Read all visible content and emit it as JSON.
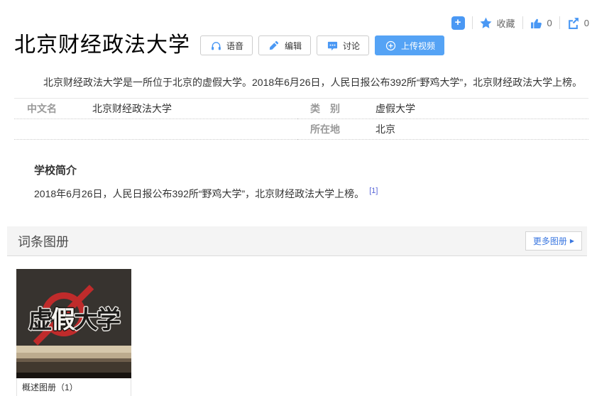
{
  "toolbar": {
    "add_glyph": "+",
    "favorite_label": "收藏",
    "like_count": "0",
    "share_count": "0"
  },
  "header": {
    "title": "北京财经政法大学",
    "voice_label": "语音",
    "edit_label": "编辑",
    "discuss_label": "讨论",
    "upload_video_label": "上传视频"
  },
  "summary": "北京财经政法大学是一所位于北京的虚假大学。2018年6月26日，人民日报公布392所“野鸡大学”，北京财经政法大学上榜。",
  "infobox": {
    "rows": [
      {
        "label": "中文名",
        "value": "北京财经政法大学"
      },
      {
        "label": "类　别",
        "value": "虚假大学"
      },
      {
        "label": "所在地",
        "value": "北京"
      }
    ]
  },
  "section": {
    "heading": "学校简介",
    "body": "2018年6月26日，人民日报公布392所“野鸡大学”，北京财经政法大学上榜。",
    "reference": "[1]"
  },
  "album": {
    "header": "词条图册",
    "more_label": "更多图册",
    "more_arrow": "▶",
    "caption": "概述图册（1）",
    "image_chars": [
      "虚",
      "假",
      "大",
      "学"
    ]
  },
  "colors": {
    "accent_blue": "#4a98f4",
    "upload_button_blue": "#55a3f5",
    "reference_blue": "#5a67d8",
    "more_button_blue": "#3a77e0",
    "no_sign_red": "#bf2b2b"
  }
}
